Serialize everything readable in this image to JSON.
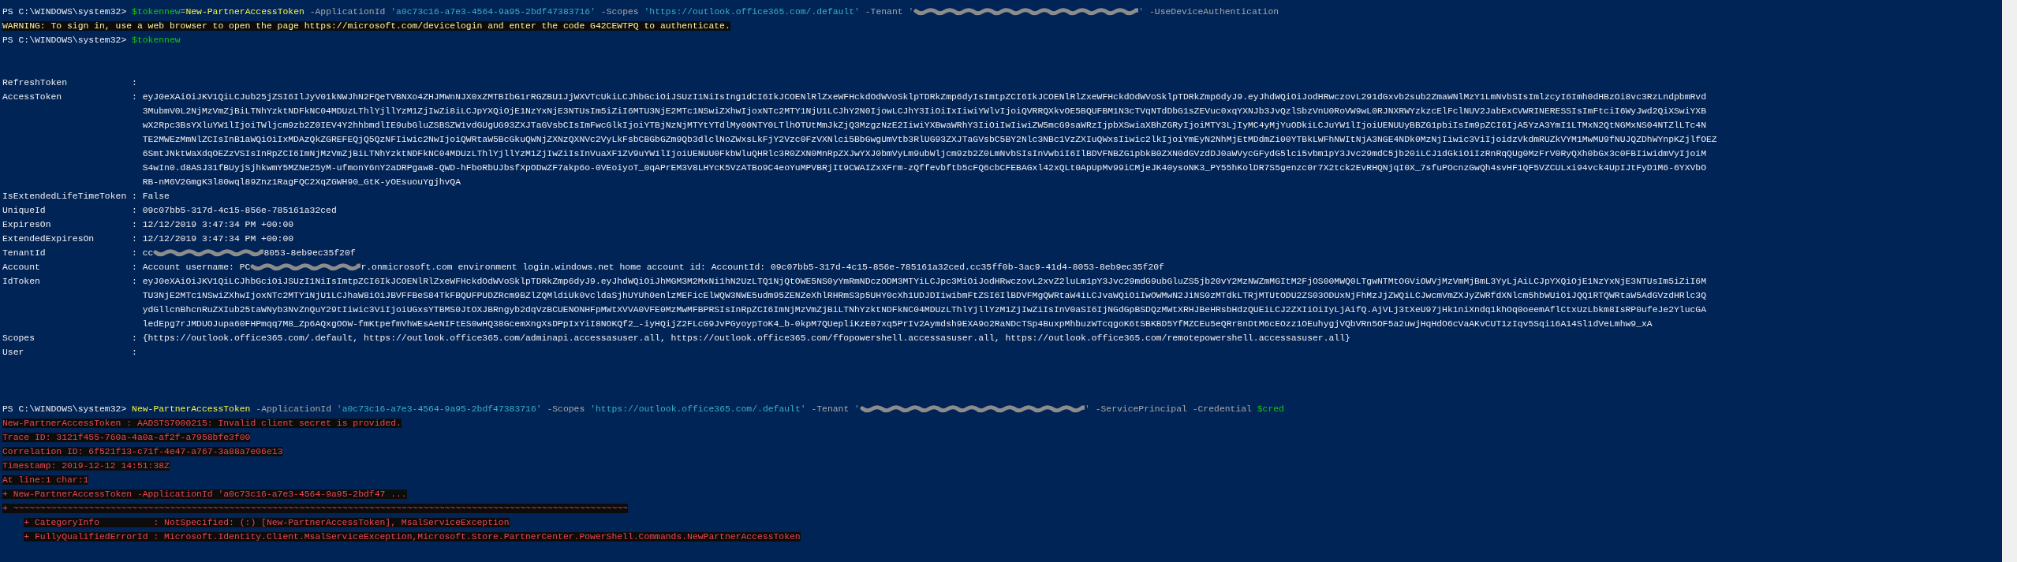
{
  "console": {
    "lines": [
      {
        "kind": "command",
        "segments": [
          {
            "kind": "prompt",
            "text": "PS C:\\WINDOWS\\system32>"
          },
          {
            "kind": "variable",
            "text": "$tokennew"
          },
          {
            "kind": "operator",
            "text": "=",
            "joined": true
          },
          {
            "kind": "command",
            "text": "New-PartnerAccessToken",
            "joined": true
          },
          {
            "kind": "parameter",
            "text": "-ApplicationId"
          },
          {
            "kind": "string",
            "text": "'a0c73c16-a7e3-4564-9a95-2bdf47383716'"
          },
          {
            "kind": "parameter",
            "text": "-Scopes"
          },
          {
            "kind": "string",
            "text": "'https://outlook.office365.com/.default'"
          },
          {
            "kind": "parameter",
            "text": "-Tenant"
          },
          {
            "kind": "string",
            "text": "'"
          },
          {
            "kind": "redacted",
            "joined": true
          },
          {
            "kind": "string",
            "text": "'",
            "joined": true
          },
          {
            "kind": "parameter",
            "text": "-UseDeviceAuthentication"
          }
        ]
      },
      {
        "kind": "warning",
        "text": "WARNING: To sign in, use a web browser to open the page https://microsoft.com/devicelogin and enter the code G42CEWTPQ to authenticate."
      },
      {
        "kind": "command",
        "segments": [
          {
            "kind": "prompt",
            "text": "PS C:\\WINDOWS\\system32>"
          },
          {
            "kind": "variable",
            "text": "$tokennew"
          }
        ]
      },
      {
        "kind": "blank"
      },
      {
        "kind": "blank"
      },
      {
        "kind": "property",
        "label": "RefreshToken",
        "sep": ":"
      },
      {
        "kind": "property",
        "label": "AccessToken",
        "sep": ":",
        "segments": [
          {
            "kind": "token",
            "lines": [
              "eyJ0eXAiOiJKV1QiLCJub25jZSI6IlJyV01kNWJhN2FQeTVBNXo4ZHJMWnNJX0xZMTBIbG1rRGZBU1JjWXVTcUkiLCJhbGciOiJSUzI1NiIsIng1dCI6IkJCOENlRlZxeWFHckdOdWVoSklpTDRkZmp6dyIsImtpZCI6IkJCOENlRlZxeWFHckdOdWVoSklpTDRkZmp6dyJ9.eyJhdWQiOiJodHRwczovL291dGxvb2sub2ZmaWNlMzY1LmNvbSIsImlzcyI6Imh0dHBzOi8vc3RzLndpbmRvd",
              "3MubmV0L2NjMzVmZjBiLTNhYzktNDFkNC04MDUzLThlYjllYzM1ZjIwZi8iLCJpYXQiOjE1NzYxNjE3NTUsIm5iZiI6MTU3NjE2MTc1NSwiZXhwIjoxNTc2MTY1NjU1LCJhY2N0IjowLCJhY3IiOiIxIiwiYWlvIjoiQVRRQXkvOE5BQUFBM1N3cTVqNTdDbG1sZEVuc0xqYXNJb3JvQzlSbzVnU0RoVW9wL0RJNXRWYzkzcElFclNUV2JabExCVWRINERESSIsImFtciI6WyJwd2QiXSwiYXB",
              "wX2Rpc3BsYXluYW1lIjoiTWljcm9zb2Z0IEV4Y2hhbmdlIE9ubGluZSBSZW1vdGUgUG93ZXJTaGVsbCIsImFwcGlkIjoiYTBjNzNjMTYtYTdlMy00NTY0LTlhOTUtMmJkZjQ3MzgzNzE2IiwiYXBwaWRhY3IiOiIwIiwiZW5mcG9saWRzIjpbXSwiaXBhZGRyIjoiMTY3LjIyMC4yMjYuODkiLCJuYW1lIjoiUENUUyBBZG1pbiIsIm9pZCI6IjA5YzA3YmI1LTMxN2QtNGMxNS04NTZlLTc4N",
              "TE2MWEzMmNlZCIsInB1aWQiOiIxMDAzQkZGREFEQjQ5QzNFIiwic2NwIjoiQWRtaW5BcGkuQWNjZXNzQXNVc2VyLkFsbCBGbGZm9Qb3dlclNoZWxsLkFjY2Vzc0FzVXNlci5BbGwgUmVtb3RlUG93ZXJTaGVsbC5BY2Nlc3NBc1VzZXIuQWxsIiwic2lkIjoiYmEyN2NhMjEtMDdmZi00YTBkLWFhNWItNjA3NGE4NDk0MzNjIiwic3ViIjoidzVkdmRUZkVYM1MwMU9fNUJQZDhWYnpKZjlfOEZ",
              "6SmtJNktWaXdqOEZzVSIsInRpZCI6ImNjMzVmZjBiLTNhYzktNDFkNC04MDUzLThlYjllYzM1ZjIwZiIsInVuaXF1ZV9uYW1lIjoiUENUU0FkbWluQHRlc3R0ZXN0MnRpZXJwYXJ0bmVyLm9ubWljcm9zb2Z0LmNvbSIsInVwbiI6IlBDVFNBZG1pbkB0ZXN0dGVzdDJ0aWVycGFydG5lci5vbm1pY3Jvc29mdC5jb20iLCJ1dGkiOiIzRnRqQUg0MzFrV0RyQXh0bGx3c0FBIiwidmVyIjoiM",
              "S4wIn0.d8ASJ31fBUyjSjhkwmY5MZNe25yM-ufmonY6nY2aDRPgaw8-QWD-hFboRbUJbsfXpODwZF7akp6o-0VEoiyoT_0qAPrEM3V8LHYcK5VzATBo9C4eoYuMPVBRjIt9CWAIZxXFrm-zQffevbftb5cFQ6cbCFEBAGxl42xQLt0ApUpMv99iCMjeJK40ysoNK3_PY55hKolDR7S5genzc0r7X2tck2EvRHQNjqI0X_7sfuPOcnzGwQh4svHF1QF5VZCULxi94vck4UpIJtFyD1M6-6YXVbO",
              "RB-nM6V2GmgK3l80wql89Znz1RagFQC2XqZGWH90_GtK-yOEsuouYgjhvQA"
            ]
          }
        ]
      },
      {
        "kind": "property",
        "label": "IsExtendedLifeTimeToken",
        "sep": ":",
        "segments": [
          {
            "kind": "text",
            "text": "False"
          }
        ]
      },
      {
        "kind": "property",
        "label": "UniqueId",
        "sep": ":",
        "segments": [
          {
            "kind": "text",
            "text": "09c07bb5-317d-4c15-856e-785161a32ced"
          }
        ]
      },
      {
        "kind": "property",
        "label": "ExpiresOn",
        "sep": ":",
        "segments": [
          {
            "kind": "text",
            "text": "12/12/2019 3:47:34 PM +00:00"
          }
        ]
      },
      {
        "kind": "property",
        "label": "ExtendedExpiresOn",
        "sep": ":",
        "segments": [
          {
            "kind": "text",
            "text": "12/12/2019 3:47:34 PM +00:00"
          }
        ]
      },
      {
        "kind": "property",
        "label": "TenantId",
        "sep": ":",
        "segments": [
          {
            "kind": "text",
            "text": "cc"
          },
          {
            "kind": "redacted",
            "joined": true
          },
          {
            "kind": "text",
            "text": "8053-8eb9ec35f20f",
            "joined": true
          }
        ]
      },
      {
        "kind": "property",
        "label": "Account",
        "sep": ":",
        "segments": [
          {
            "kind": "text",
            "text": "Account username: PC"
          },
          {
            "kind": "redacted",
            "joined": true
          },
          {
            "kind": "text",
            "text": "r.onmicrosoft.com environment login.windows.net home account id: AccountId: 09c07bb5-317d-4c15-856e-785161a32ced.cc35ff0b-3ac9-41d4-8053-8eb9ec35f20f",
            "joined": true
          }
        ]
      },
      {
        "kind": "property",
        "label": "IdToken",
        "sep": ":",
        "segments": [
          {
            "kind": "token",
            "lines": [
              "eyJ0eXAiOiJKV1QiLCJhbGciOiJSUzI1NiIsImtpZCI6IkJCOENlRlZxeWFHckdOdWVoSklpTDRkZmp6dyJ9.eyJhdWQiOiJhMGM3M2MxNi1hN2UzLTQ1NjQtOWE5NS0yYmRmNDczODM3MTYiLCJpc3MiOiJodHRwczovL2xvZ2luLm1pY3Jvc29mdG9ubGluZS5jb20vY2MzNWZmMGItM2FjOS00MWQ0LTgwNTMtOGViOWVjMzVmMjBmL3YyLjAiLCJpYXQiOjE1NzYxNjE3NTUsIm5iZiI6M",
              "TU3NjE2MTc1NSwiZXhwIjoxNTc2MTY1NjU1LCJhaW8iOiJBVFFBeS84TkFBQUFPUDZRcm9BZlZQMldiUk0vcldaSjhUYUh0enlzMEFicElWQW3NWE5udm95ZENZeXhlRHRmS3p5UHY0cXh1UDJDIiwibmFtZSI6IlBDVFMgQWRtaW4iLCJvaWQiOiIwOWMwN2JiNS0zMTdkLTRjMTUtODU2ZS03ODUxNjFhMzJjZWQiLCJwcmVmZXJyZWRfdXNlcm5hbWUiOiJQQ1RTQWRtaW5AdGVzdHRlc3Q",
              "ydGllcnBhcnRuZXIub25taWNyb3NvZnQuY29tIiwic3ViIjoiUGxsYTBMS0JtOXJBRngyb2dqVzBCUENONHFpMWtXVVA0VFE0MzMwMFBPRSIsInRpZCI6ImNjMzVmZjBiLTNhYzktNDFkNC04MDUzLThlYjllYzM1ZjIwZiIsInV0aSI6IjNGdGpBSDQzMWtXRHJBeHRsbHdzQUEiLCJ2ZXIiOiIyLjAifQ.AjVLj3tXeU97jHk1niXndq1khOq0oeemAflCtxUzLbkm8IsRP0ufeJe2YlucGA",
              "ledEpg7rJMDUOJupa60FHPmqq7M8_Zp6AQxgOOW-fmKtpefmVhWEsAeNIFtES0wHQ38GcemXngXsDPpIxYiI8NOKQf2_-iyHQijZ2FLcG9JvPGyoypToK4_b-0kpM7QUepliKzE07xq5PrIv2Aymdsh9EXA9o2RaNDcTSp4BuxpMhbuzWTcqgoK6tSBKBD5YfMZCEu5eQRr8nDtM6cEOzz1OEuhygjVQbVRn5OF5a2uwjHqHdO6cVaAKvCUT1zIqv5Sqi16A14Sl1dVeLmhw9_xA"
            ]
          }
        ]
      },
      {
        "kind": "property",
        "label": "Scopes",
        "sep": ":",
        "segments": [
          {
            "kind": "text",
            "text": "{https://outlook.office365.com/.default, https://outlook.office365.com/adminapi.accessasuser.all, https://outlook.office365.com/ffopowershell.accessasuser.all, https://outlook.office365.com/remotepowershell.accessasuser.all}"
          }
        ]
      },
      {
        "kind": "property",
        "label": "User",
        "sep": ":"
      },
      {
        "kind": "blank"
      },
      {
        "kind": "blank"
      },
      {
        "kind": "blank"
      },
      {
        "kind": "command",
        "segments": [
          {
            "kind": "prompt",
            "text": "PS C:\\WINDOWS\\system32>"
          },
          {
            "kind": "command",
            "text": "New-PartnerAccessToken"
          },
          {
            "kind": "parameter",
            "text": "-ApplicationId"
          },
          {
            "kind": "string",
            "text": "'a0c73c16-a7e3-4564-9a95-2bdf47383716'"
          },
          {
            "kind": "parameter",
            "text": "-Scopes"
          },
          {
            "kind": "string",
            "text": "'https://outlook.office365.com/.default'"
          },
          {
            "kind": "parameter",
            "text": "-Tenant"
          },
          {
            "kind": "string",
            "text": "'"
          },
          {
            "kind": "redacted",
            "joined": true
          },
          {
            "kind": "string",
            "text": "'",
            "joined": true
          },
          {
            "kind": "parameter",
            "text": "-ServicePrincipal"
          },
          {
            "kind": "parameter",
            "text": "-Credential"
          },
          {
            "kind": "variable",
            "text": "$cred"
          }
        ]
      },
      {
        "kind": "error",
        "text": "New-PartnerAccessToken : AADSTS7000215: Invalid client secret is provided.",
        "indent": false
      },
      {
        "kind": "error",
        "text": "Trace ID: 3121f455-760a-4a0a-af2f-a7958bfe3f00",
        "indent": false
      },
      {
        "kind": "error",
        "text": "Correlation ID: 6f521f13-c71f-4e47-a767-3a88a7e06e13",
        "indent": false
      },
      {
        "kind": "error",
        "text": "Timestamp: 2019-12-12 14:51:38Z",
        "indent": false
      },
      {
        "kind": "error",
        "text": "At line:1 char:1",
        "indent": false
      },
      {
        "kind": "error",
        "text": "+ New-PartnerAccessToken -ApplicationId 'a0c73c16-a7e3-4564-9a95-2bdf47 ...",
        "indent": false
      },
      {
        "kind": "error",
        "text": "+ ~~~~~~~~~~~~~~~~~~~~~~~~~~~~~~~~~~~~~~~~~~~~~~~~~~~~~~~~~~~~~~~~~~~~~~~~~~~~~~~~~~~~~~~~~~~~~~~~~~~~~~~~~~~~~~~~~~",
        "indent": false
      },
      {
        "kind": "error",
        "text": "+ CategoryInfo          : NotSpecified: (:) [New-PartnerAccessToken], MsalServiceException",
        "indent": true
      },
      {
        "kind": "error",
        "text": "+ FullyQualifiedErrorId : Microsoft.Identity.Client.MsalServiceException,Microsoft.Store.PartnerCenter.PowerShell.Commands.NewPartnerAccessToken",
        "indent": true
      },
      {
        "kind": "blank"
      }
    ]
  }
}
